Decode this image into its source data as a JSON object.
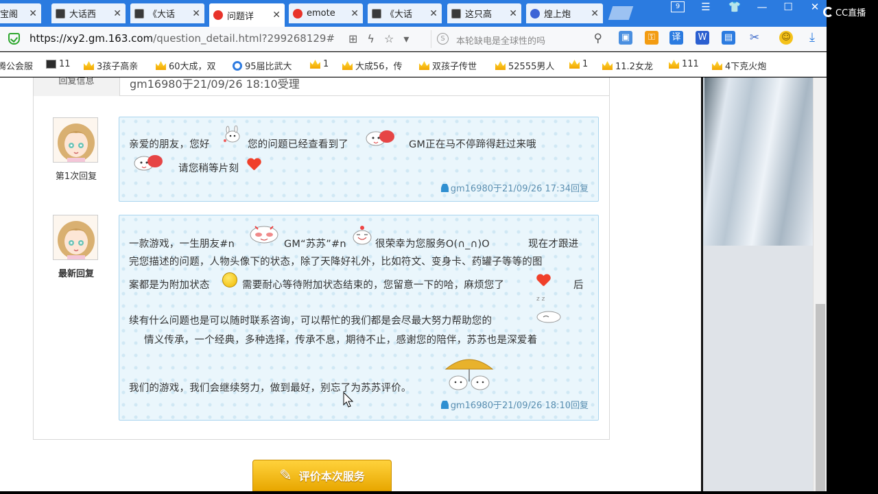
{
  "tabs": [
    {
      "label": "宝阁",
      "icon": "none"
    },
    {
      "label": "大话西",
      "icon": "dark"
    },
    {
      "label": "《大话",
      "icon": "dark"
    },
    {
      "label": "问题详",
      "icon": "red"
    },
    {
      "label": "emote",
      "icon": "red"
    },
    {
      "label": "《大话",
      "icon": "dark"
    },
    {
      "label": "这只高",
      "icon": "dark"
    },
    {
      "label": "煌上炮",
      "icon": "paw"
    }
  ],
  "tab_count": "9",
  "address": {
    "host": "https://xy2.gm.163.com",
    "path": "/question_detail.html?299268129#",
    "search_placeholder": "本轮缺电是全球性的吗"
  },
  "bookmarks": [
    {
      "label": "腾公会服",
      "icon": "none"
    },
    {
      "label": "11",
      "icon": "dark"
    },
    {
      "label": "3孩子高亲",
      "icon": "crown"
    },
    {
      "label": "60大成，双",
      "icon": "crown"
    },
    {
      "label": "95届比武大",
      "icon": "ring"
    },
    {
      "label": "1",
      "icon": "crown"
    },
    {
      "label": "大成56，传",
      "icon": "crown"
    },
    {
      "label": "双孩子传世",
      "icon": "crown"
    },
    {
      "label": "52555男人",
      "icon": "crown"
    },
    {
      "label": "1",
      "icon": "crown"
    },
    {
      "label": "11.2女龙",
      "icon": "crown"
    },
    {
      "label": "111",
      "icon": "crown"
    },
    {
      "label": "4下克火炮",
      "icon": "crown"
    }
  ],
  "reply_header": {
    "label": "回复信息",
    "value": "gm16980于21/09/26 18:10受理"
  },
  "replies": [
    {
      "caption": "第1次回复",
      "lines": [
        {
          "segments": [
            "亲爱的朋友，您好",
            "您的问题已经查看到了",
            "GM正在马不停蹄得赶过来哦"
          ]
        },
        {
          "segments": [
            "请您稍等片刻"
          ]
        }
      ],
      "signature": "gm16980于21/09/26 17:34回复"
    },
    {
      "caption": "最新回复",
      "lines": [
        {
          "segments": [
            "一款游戏，一生朋友#n",
            "GM“苏苏”#n",
            "很荣幸为您服务O(∩_∩)O",
            "现在才跟进"
          ]
        },
        {
          "segments": [
            "完您描述的问题，人物头像下的状态，除了天降好礼外，比如符文、变身卡、药罐子等等的图"
          ]
        },
        {
          "segments": [
            "案都是为附加状态",
            "需要耐心等待附加状态结束的，您留意一下的哈，麻烦您了",
            "后"
          ]
        },
        {
          "segments": [
            "续有什么问题也是可以随时联系咨询，可以帮忙的我们都是会尽最大努力帮助您的"
          ]
        },
        {
          "segments": [
            "情义传承，一个经典，多种选择，传承不息，期待不止，感谢您的陪伴，苏苏也是深爱着"
          ]
        },
        {
          "segments": [
            "我们的游戏，我们会继续努力，做到最好，别忘了为苏苏评价。"
          ]
        }
      ],
      "signature": "gm16980于21/09/26 18:10回复"
    }
  ],
  "rate_button": "评价本次服务",
  "branding": {
    "logo_text": "CC直播"
  },
  "colors": {
    "tabbar": "#2b7be0",
    "bubble_bg": "#eaf6fc",
    "bubble_border": "#a8d4ee",
    "signature": "#5a8fb1",
    "button": "#f2b70c"
  }
}
